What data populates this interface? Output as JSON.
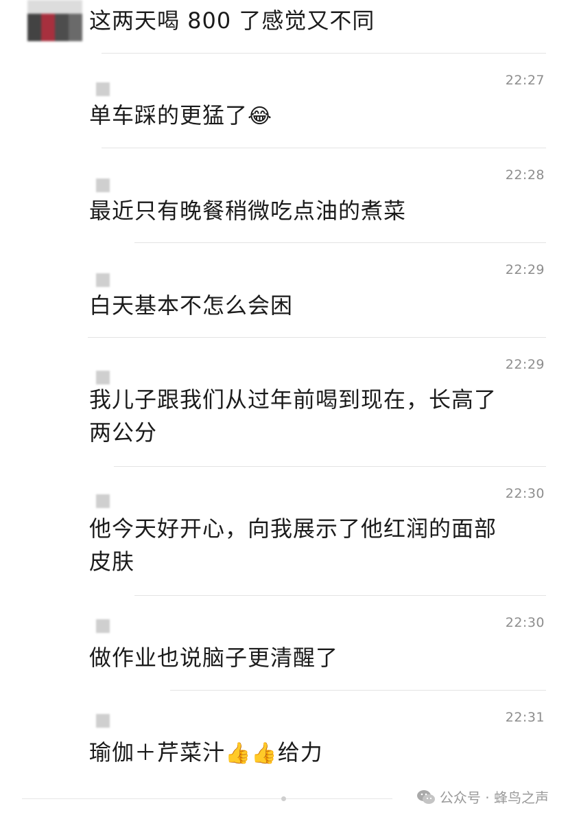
{
  "messages": [
    {
      "text": "这两天喝 800 了感觉又不同",
      "time": ""
    },
    {
      "text": "单车踩的更猛了",
      "time": "22:27",
      "emoji": "😂"
    },
    {
      "text": "最近只有晚餐稍微吃点油的煮菜",
      "time": "22:28"
    },
    {
      "text": "白天基本不怎么会困",
      "time": "22:29"
    },
    {
      "text": "我儿子跟我们从过年前喝到现在，长高了\n两公分",
      "time": "22:29"
    },
    {
      "text": "他今天好开心，向我展示了他红润的面部\n皮肤",
      "time": "22:30"
    },
    {
      "text": "做作业也说脑子更清醒了",
      "time": "22:30"
    },
    {
      "text": "瑜伽＋芹菜汁",
      "text_suffix": "给力",
      "time": "22:31",
      "emoji": "👍👍"
    }
  ],
  "footer": {
    "icon": "wechat-icon",
    "label": "公众号 · 蜂鸟之声"
  },
  "colors": {
    "text": "#1b1b1b",
    "time": "#8d8d8d",
    "divider": "#e3e3e3"
  }
}
